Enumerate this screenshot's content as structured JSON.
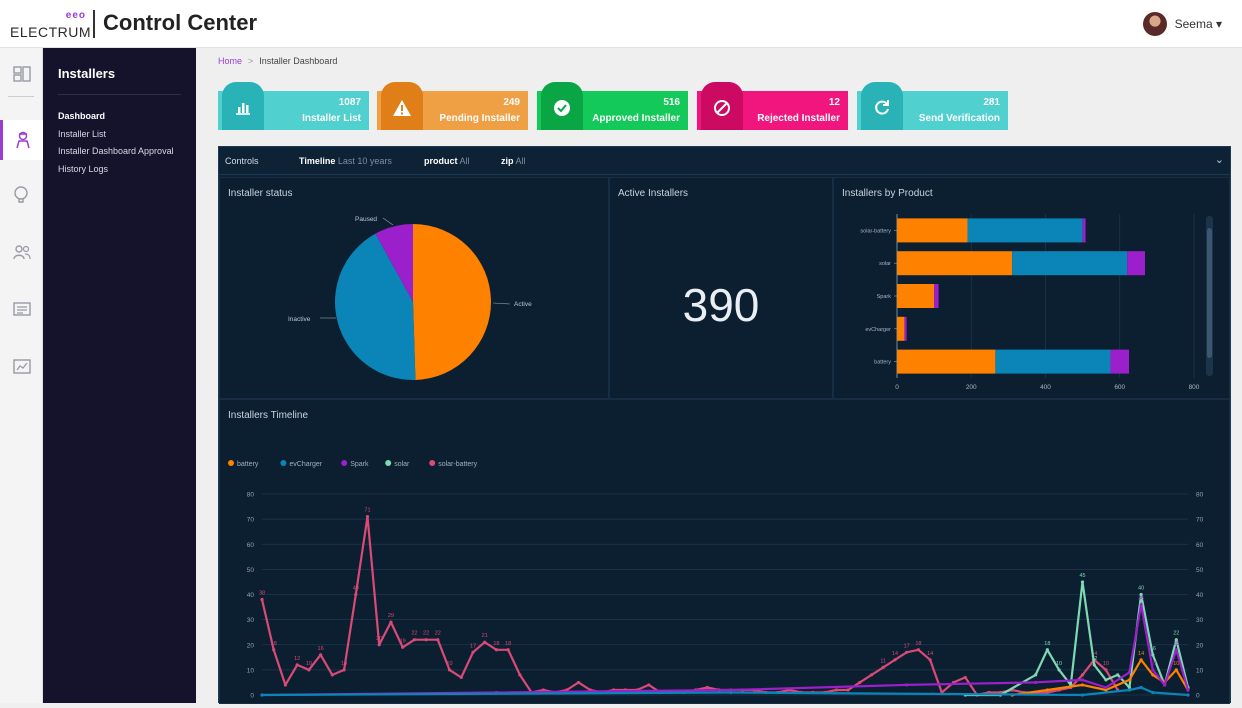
{
  "header": {
    "brand": "ELECTRUM",
    "brand_mark": "eeo",
    "title": "Control Center",
    "user_name": "Seema",
    "user_caret": "▾"
  },
  "rail": {
    "icons": [
      "dashboard-icon",
      "installer-icon",
      "idea-icon",
      "users-icon",
      "list-icon",
      "report-icon"
    ]
  },
  "sidebar": {
    "title": "Installers",
    "items": [
      {
        "label": "Dashboard"
      },
      {
        "label": "Installer List"
      },
      {
        "label": "Installer Dashboard Approval"
      },
      {
        "label": "History Logs"
      }
    ]
  },
  "breadcrumb": {
    "home": "Home",
    "separator": ">",
    "current": "Installer Dashboard"
  },
  "cards": [
    {
      "count": "1087",
      "label": "Installer List",
      "color": "#50d0cf",
      "tab_color": "#2ab3b6",
      "icon": "bar-chart-icon"
    },
    {
      "count": "249",
      "label": "Pending Installer",
      "color": "#f0a044",
      "tab_color": "#e07f18",
      "icon": "warning-icon"
    },
    {
      "count": "516",
      "label": "Approved Installer",
      "color": "#12c95a",
      "tab_color": "#0aa646",
      "icon": "check-circle-icon"
    },
    {
      "count": "12",
      "label": "Rejected Installer",
      "color": "#f0167e",
      "tab_color": "#cc0a62",
      "icon": "ban-icon"
    },
    {
      "count": "281",
      "label": "Send Verification",
      "color": "#50d0cf",
      "tab_color": "#2ab3b6",
      "icon": "refresh-icon"
    }
  ],
  "controls": {
    "label": "Controls",
    "timeline_key": "Timeline",
    "timeline_val": "Last 10 years",
    "product_key": "product",
    "product_val": "All",
    "zip_key": "zip",
    "zip_val": "All",
    "chevron": "⌄"
  },
  "installer_status": {
    "title": "Installer status",
    "labels": {
      "paused": "Paused",
      "inactive": "Inactive",
      "active": "Active"
    }
  },
  "active_installers": {
    "title": "Active Installers",
    "value": "390"
  },
  "by_product": {
    "title": "Installers by Product"
  },
  "timeline": {
    "title": "Installers Timeline"
  },
  "colors": {
    "orange": "#ff8100",
    "blue": "#0b84b8",
    "purple": "#9b1fcb",
    "teal": "#7ed9b3",
    "pink": "#d94a77",
    "accent": "#9b3dd1"
  },
  "chart_data": [
    {
      "type": "pie",
      "slices": [
        {
          "label": "Active",
          "value": 49.5,
          "color": "#ff8100"
        },
        {
          "label": "Inactive",
          "value": 42.5,
          "color": "#0b84b8"
        },
        {
          "label": "Paused",
          "value": 8.0,
          "color": "#9b1fcb"
        }
      ]
    },
    {
      "type": "bar",
      "orientation": "horizontal",
      "stacked": true,
      "categories": [
        "solar-battery",
        "solar",
        "Spark",
        "evCharger",
        "battery"
      ],
      "xlim": [
        0,
        800
      ],
      "xticks": [
        "0",
        "200",
        "400",
        "600",
        "800"
      ],
      "series": [
        {
          "values": [
            190,
            310,
            100,
            20,
            265
          ],
          "color": "#ff8100"
        },
        {
          "values": [
            310,
            310,
            0,
            0,
            310
          ],
          "color": "#0b84b8"
        },
        {
          "values": [
            8,
            48,
            12,
            6,
            50
          ],
          "color": "#9b1fcb"
        }
      ]
    },
    {
      "type": "line",
      "legend": [
        {
          "name": "battery",
          "color": "#ff8100"
        },
        {
          "name": "evCharger",
          "color": "#0b84b8"
        },
        {
          "name": "Spark",
          "color": "#9b1fcb"
        },
        {
          "name": "solar",
          "color": "#7ed9b3"
        },
        {
          "name": "solar-battery",
          "color": "#d94a77"
        }
      ],
      "yticks": [
        "0",
        "10",
        "20",
        "30",
        "40",
        "50",
        "60",
        "70",
        "80"
      ],
      "ylim": [
        0,
        80
      ],
      "x_count": 74,
      "series": [
        {
          "name": "solar-battery",
          "color": "#d94a77",
          "points": [
            [
              0,
              38
            ],
            [
              1,
              18
            ],
            [
              2,
              4
            ],
            [
              3,
              12
            ],
            [
              4,
              10
            ],
            [
              5,
              16
            ],
            [
              6,
              8
            ],
            [
              7,
              10
            ],
            [
              8,
              40
            ],
            [
              9,
              71
            ],
            [
              10,
              20
            ],
            [
              11,
              29
            ],
            [
              12,
              19
            ],
            [
              13,
              22
            ],
            [
              14,
              22
            ],
            [
              15,
              22
            ],
            [
              16,
              10
            ],
            [
              17,
              7
            ],
            [
              18,
              17
            ],
            [
              19,
              21
            ],
            [
              20,
              18
            ],
            [
              21,
              18
            ],
            [
              22,
              8
            ],
            [
              23,
              1
            ],
            [
              24,
              2
            ],
            [
              25,
              1
            ],
            [
              26,
              2
            ],
            [
              27,
              5
            ],
            [
              28,
              2
            ],
            [
              29,
              1
            ],
            [
              30,
              2
            ],
            [
              31,
              2
            ],
            [
              32,
              2
            ],
            [
              33,
              4
            ],
            [
              34,
              1
            ],
            [
              35,
              1
            ],
            [
              36,
              1
            ],
            [
              37,
              2
            ],
            [
              38,
              3
            ],
            [
              39,
              2
            ],
            [
              40,
              2
            ],
            [
              41,
              2
            ],
            [
              42,
              2
            ],
            [
              43,
              1
            ],
            [
              44,
              1
            ],
            [
              45,
              2
            ],
            [
              46,
              1
            ],
            [
              47,
              1
            ],
            [
              48,
              1
            ],
            [
              49,
              2
            ],
            [
              50,
              2
            ],
            [
              51,
              5
            ],
            [
              52,
              8
            ],
            [
              53,
              11
            ],
            [
              54,
              14
            ],
            [
              55,
              17
            ],
            [
              56,
              18
            ],
            [
              57,
              14
            ],
            [
              58,
              1
            ],
            [
              59,
              5
            ],
            [
              60,
              7
            ],
            [
              61,
              0
            ],
            [
              62,
              1
            ],
            [
              63,
              1
            ],
            [
              64,
              2
            ],
            [
              65,
              1
            ],
            [
              66,
              1
            ],
            [
              67,
              1
            ],
            [
              68,
              2
            ],
            [
              69,
              3
            ],
            [
              70,
              8
            ],
            [
              71,
              14
            ],
            [
              72,
              10
            ],
            [
              73,
              2
            ]
          ]
        },
        {
          "name": "solar",
          "color": "#7ed9b3",
          "points": [
            [
              60,
              0
            ],
            [
              63,
              0
            ],
            [
              66,
              8
            ],
            [
              67,
              18
            ],
            [
              68,
              10
            ],
            [
              69,
              4
            ],
            [
              70,
              45
            ],
            [
              71,
              12
            ],
            [
              72,
              6
            ],
            [
              73,
              8
            ],
            [
              74,
              3
            ],
            [
              75,
              40
            ],
            [
              76,
              16
            ],
            [
              77,
              4
            ],
            [
              78,
              22
            ],
            [
              79,
              3
            ]
          ]
        },
        {
          "name": "battery",
          "color": "#ff8100",
          "points": [
            [
              64,
              0
            ],
            [
              67,
              2
            ],
            [
              70,
              4
            ],
            [
              72,
              2
            ],
            [
              74,
              6
            ],
            [
              75,
              14
            ],
            [
              76,
              8
            ],
            [
              77,
              5
            ],
            [
              78,
              10
            ],
            [
              79,
              2
            ]
          ]
        },
        {
          "name": "Spark",
          "color": "#9b1fcb",
          "points": [
            [
              0,
              0
            ],
            [
              20,
              1
            ],
            [
              40,
              2
            ],
            [
              55,
              4
            ],
            [
              66,
              5
            ],
            [
              70,
              6
            ],
            [
              72,
              3
            ],
            [
              74,
              9
            ],
            [
              75,
              36
            ],
            [
              76,
              10
            ],
            [
              77,
              4
            ],
            [
              78,
              18
            ],
            [
              79,
              2
            ]
          ]
        },
        {
          "name": "evCharger",
          "color": "#0b84b8",
          "points": [
            [
              0,
              0
            ],
            [
              40,
              1
            ],
            [
              70,
              0
            ],
            [
              74,
              2
            ],
            [
              75,
              3
            ],
            [
              76,
              1
            ],
            [
              79,
              0
            ]
          ]
        }
      ]
    }
  ]
}
